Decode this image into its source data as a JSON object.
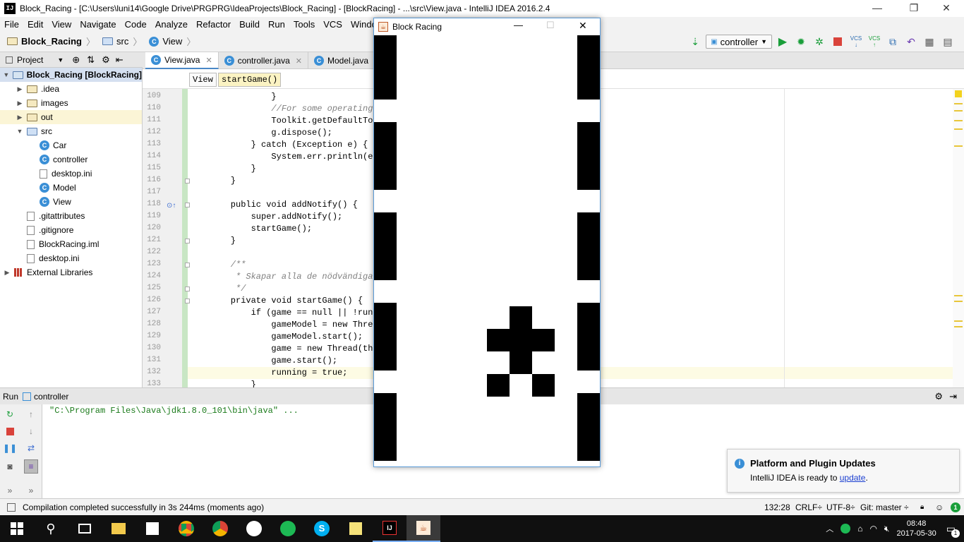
{
  "window": {
    "app_icon": "IJ",
    "title": "Block_Racing - [C:\\Users\\luni14\\Google Drive\\PRGPRG\\IdeaProjects\\Block_Racing] - [BlockRacing] - ...\\src\\View.java - IntelliJ IDEA 2016.2.4",
    "controls": [
      "—",
      "❐",
      "✕"
    ]
  },
  "menu": [
    "File",
    "Edit",
    "View",
    "Navigate",
    "Code",
    "Analyze",
    "Refactor",
    "Build",
    "Run",
    "Tools",
    "VCS",
    "Window",
    "H"
  ],
  "navbar": {
    "project": "Block_Racing",
    "folder": "src",
    "file": "View"
  },
  "toolbar": {
    "run_config": "controller",
    "vcs_labels": [
      "VCS",
      "VCS"
    ]
  },
  "project_panel": {
    "header": "Project",
    "items": [
      {
        "label": "Block_Racing [BlockRacing]",
        "icon": "project-folder-icon",
        "depth": 0,
        "arrow": "▼"
      },
      {
        "label": ".idea",
        "icon": "folder-icon",
        "depth": 1,
        "arrow": "▶"
      },
      {
        "label": "images",
        "icon": "folder-icon",
        "depth": 1,
        "arrow": "▶"
      },
      {
        "label": "out",
        "icon": "folder-icon",
        "depth": 1,
        "arrow": "▶"
      },
      {
        "label": "src",
        "icon": "source-folder-icon",
        "depth": 1,
        "arrow": "▼"
      },
      {
        "label": "Car",
        "icon": "class-icon",
        "depth": 2,
        "arrow": ""
      },
      {
        "label": "controller",
        "icon": "class-icon",
        "depth": 2,
        "arrow": ""
      },
      {
        "label": "desktop.ini",
        "icon": "file-icon",
        "depth": 2,
        "arrow": ""
      },
      {
        "label": "Model",
        "icon": "class-icon",
        "depth": 2,
        "arrow": ""
      },
      {
        "label": "View",
        "icon": "class-icon",
        "depth": 2,
        "arrow": ""
      },
      {
        "label": ".gitattributes",
        "icon": "file-icon",
        "depth": 1,
        "arrow": ""
      },
      {
        "label": ".gitignore",
        "icon": "file-icon",
        "depth": 1,
        "arrow": ""
      },
      {
        "label": "BlockRacing.iml",
        "icon": "file-icon",
        "depth": 1,
        "arrow": ""
      },
      {
        "label": "desktop.ini",
        "icon": "file-icon",
        "depth": 1,
        "arrow": ""
      },
      {
        "label": "External Libraries",
        "icon": "library-icon",
        "depth": 0,
        "arrow": "▶"
      }
    ]
  },
  "editor_tabs": [
    {
      "label": "View.java",
      "active": true
    },
    {
      "label": "controller.java",
      "active": false
    },
    {
      "label": "Model.java",
      "active": false
    }
  ],
  "editor_breadcrumb": [
    "View",
    "startGame()"
  ],
  "code_lines": [
    {
      "n": "109",
      "text": "            }"
    },
    {
      "n": "110",
      "text": "            //For some operating syst"
    },
    {
      "n": "111",
      "text": "            Toolkit.getDefaultToolkit"
    },
    {
      "n": "112",
      "text": "            g.dispose();"
    },
    {
      "n": "113",
      "text": "        } catch (Exception e) {"
    },
    {
      "n": "114",
      "text": "            System.err.println(e);"
    },
    {
      "n": "115",
      "text": "        }"
    },
    {
      "n": "116",
      "text": "    }"
    },
    {
      "n": "117",
      "text": ""
    },
    {
      "n": "118",
      "text": "    public void addNotify() {"
    },
    {
      "n": "119",
      "text": "        super.addNotify();"
    },
    {
      "n": "120",
      "text": "        startGame();"
    },
    {
      "n": "121",
      "text": "    }"
    },
    {
      "n": "122",
      "text": ""
    },
    {
      "n": "123",
      "text": "    /**"
    },
    {
      "n": "124",
      "text": "     * Skapar alla de nödvändiga dela"
    },
    {
      "n": "125",
      "text": "     */"
    },
    {
      "n": "126",
      "text": "    private void startGame() {"
    },
    {
      "n": "127",
      "text": "        if (game == null || !running)"
    },
    {
      "n": "128",
      "text": "            gameModel = new Thread(mo"
    },
    {
      "n": "129",
      "text": "            gameModel.start();"
    },
    {
      "n": "130",
      "text": "            game = new Thread(this);"
    },
    {
      "n": "131",
      "text": "            game.start();"
    },
    {
      "n": "132",
      "text": "            running = true;"
    },
    {
      "n": "133",
      "text": "        }"
    }
  ],
  "run_panel": {
    "title": "Run",
    "config": "controller",
    "output": "\"C:\\Program Files\\Java\\jdk1.8.0_101\\bin\\java\" ..."
  },
  "notification": {
    "title": "Platform and Plugin Updates",
    "text": "IntelliJ IDEA is ready to",
    "link": "update",
    "after": "."
  },
  "statusbar": {
    "message": "Compilation completed successfully in 3s 244ms (moments ago)",
    "position": "132:28",
    "line_sep": "CRLF÷",
    "encoding": "UTF-8÷",
    "vcs": "Git: master ÷"
  },
  "game_window": {
    "title": "Block Racing",
    "controls": [
      "—",
      "☐",
      "✕"
    ]
  },
  "taskbar": {
    "time": "08:48",
    "date": "2017-05-30",
    "notif_count": "1"
  },
  "colors": {
    "accent": "#4a88c7",
    "class_icon": "#3a8fd6",
    "run_green": "#1a9e3a",
    "string_green": "#008000",
    "keyword": "#000080",
    "comment": "#808080",
    "field": "#660e7a"
  }
}
